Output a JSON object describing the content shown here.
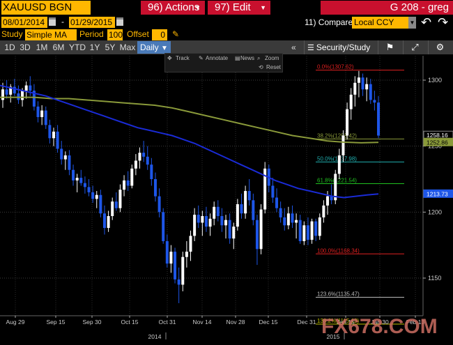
{
  "window": {
    "ticker": "XAUUSD BGN Curncy",
    "actions_label": "96) Actions",
    "edit_label": "97) Edit",
    "right_title": "G 208 - greg"
  },
  "controls": {
    "start_date": "08/01/2014",
    "end_date": "01/29/2015",
    "date_separator": "-",
    "compare_label": "11) Compare",
    "compare_currency": "Local CCY",
    "study_label": "Study",
    "study_value": "Simple MA",
    "period_label": "Period",
    "period_value": "100",
    "offset_label": "Offset",
    "offset_value": "0"
  },
  "toolbar": {
    "timeframes": [
      "1D",
      "3D",
      "1M",
      "6M",
      "YTD",
      "1Y",
      "5Y",
      "Max"
    ],
    "frequency": "Daily",
    "collapse_symbol": "«",
    "security_study_label": "Security/Study",
    "icons": [
      "flag-icon",
      "fullscreen-icon",
      "gear-icon"
    ]
  },
  "chart_tools": {
    "track": "Track",
    "annotate": "Annotate",
    "news": "News",
    "zoom": "Zoom",
    "reset": "Reset"
  },
  "watermark": {
    "text": "FX678.COM"
  },
  "colors": {
    "ticker_bg": "#ffb700",
    "menu_red": "#c8102e",
    "bull_candle": "#ffffff",
    "bear_candle": "#1e56e8",
    "ma100": "#1a2bd6",
    "ma200": "#8a9a3a",
    "fib_red": "#e02020",
    "fib_green": "#20c020",
    "fib_cyan": "#20b0b0",
    "last_price_tag": "#1e56e8",
    "ma_tag": "#8a9a3a"
  },
  "chart_data": {
    "type": "candlestick",
    "y_range": [
      1120,
      1330
    ],
    "y_ticks": [
      1150,
      1200,
      1250,
      1300
    ],
    "x_labels": [
      {
        "label": "Aug 29",
        "year": ""
      },
      {
        "label": "Sep 15",
        "year": ""
      },
      {
        "label": "Sep 30",
        "year": ""
      },
      {
        "label": "Oct 15",
        "year": ""
      },
      {
        "label": "Oct 31",
        "year": "2014"
      },
      {
        "label": "Nov 14",
        "year": ""
      },
      {
        "label": "Nov 28",
        "year": ""
      },
      {
        "label": "Dec 15",
        "year": ""
      },
      {
        "label": "Dec 31",
        "year": ""
      },
      {
        "label": "Jan 15",
        "year": "2015"
      },
      {
        "label": "Jan 30",
        "year": ""
      },
      {
        "label": "Feb 13",
        "year": ""
      }
    ],
    "fib_levels": [
      {
        "label": "0.0%",
        "value": 1307.62,
        "text": "1307.62",
        "color": "#e02020"
      },
      {
        "label": "38.2%",
        "value": 1255.42,
        "text": "1255.42",
        "color": "#8a9a3a"
      },
      {
        "label": "50.0%",
        "value": 1237.98,
        "text": "1237.98",
        "color": "#20b0b0"
      },
      {
        "label": "61.8%",
        "value": 1221.54,
        "text": "1221.54",
        "color": "#20c020"
      },
      {
        "label": "100.0%",
        "value": 1168.34,
        "text": "1168.34",
        "color": "#e02020"
      },
      {
        "label": "123.6%",
        "value": 1135.47,
        "text": "1135.47",
        "color": "#bbbbbb"
      },
      {
        "label": "138.2%",
        "value": 1115.13,
        "text": "1115.13",
        "color": "#c0c000"
      }
    ],
    "price_tags": [
      {
        "text": "1258.16",
        "value": 1258.16,
        "kind": "last"
      },
      {
        "text": "1252.86",
        "value": 1252.86,
        "kind": "ma200"
      },
      {
        "text": "1213.73",
        "value": 1213.73,
        "kind": "ma100"
      }
    ],
    "candles": [
      {
        "o": 1285,
        "h": 1298,
        "l": 1279,
        "c": 1293
      },
      {
        "o": 1293,
        "h": 1300,
        "l": 1286,
        "c": 1289
      },
      {
        "o": 1289,
        "h": 1297,
        "l": 1283,
        "c": 1295
      },
      {
        "o": 1295,
        "h": 1301,
        "l": 1288,
        "c": 1290
      },
      {
        "o": 1290,
        "h": 1296,
        "l": 1282,
        "c": 1285
      },
      {
        "o": 1285,
        "h": 1294,
        "l": 1280,
        "c": 1292
      },
      {
        "o": 1292,
        "h": 1299,
        "l": 1286,
        "c": 1296
      },
      {
        "o": 1296,
        "h": 1303,
        "l": 1288,
        "c": 1292
      },
      {
        "o": 1292,
        "h": 1297,
        "l": 1277,
        "c": 1280
      },
      {
        "o": 1280,
        "h": 1284,
        "l": 1268,
        "c": 1272
      },
      {
        "o": 1272,
        "h": 1281,
        "l": 1266,
        "c": 1277
      },
      {
        "o": 1277,
        "h": 1280,
        "l": 1263,
        "c": 1266
      },
      {
        "o": 1266,
        "h": 1270,
        "l": 1252,
        "c": 1256
      },
      {
        "o": 1256,
        "h": 1264,
        "l": 1250,
        "c": 1261
      },
      {
        "o": 1261,
        "h": 1266,
        "l": 1245,
        "c": 1248
      },
      {
        "o": 1248,
        "h": 1254,
        "l": 1236,
        "c": 1240
      },
      {
        "o": 1240,
        "h": 1246,
        "l": 1232,
        "c": 1243
      },
      {
        "o": 1243,
        "h": 1247,
        "l": 1228,
        "c": 1232
      },
      {
        "o": 1232,
        "h": 1236,
        "l": 1220,
        "c": 1224
      },
      {
        "o": 1224,
        "h": 1229,
        "l": 1215,
        "c": 1226
      },
      {
        "o": 1226,
        "h": 1232,
        "l": 1220,
        "c": 1222
      },
      {
        "o": 1222,
        "h": 1227,
        "l": 1214,
        "c": 1219
      },
      {
        "o": 1219,
        "h": 1225,
        "l": 1212,
        "c": 1215
      },
      {
        "o": 1215,
        "h": 1220,
        "l": 1207,
        "c": 1210
      },
      {
        "o": 1210,
        "h": 1216,
        "l": 1203,
        "c": 1213
      },
      {
        "o": 1213,
        "h": 1217,
        "l": 1196,
        "c": 1199
      },
      {
        "o": 1199,
        "h": 1205,
        "l": 1183,
        "c": 1188
      },
      {
        "o": 1188,
        "h": 1201,
        "l": 1185,
        "c": 1197
      },
      {
        "o": 1197,
        "h": 1211,
        "l": 1194,
        "c": 1208
      },
      {
        "o": 1208,
        "h": 1215,
        "l": 1201,
        "c": 1203
      },
      {
        "o": 1203,
        "h": 1221,
        "l": 1200,
        "c": 1217
      },
      {
        "o": 1217,
        "h": 1228,
        "l": 1212,
        "c": 1224
      },
      {
        "o": 1224,
        "h": 1231,
        "l": 1216,
        "c": 1220
      },
      {
        "o": 1220,
        "h": 1236,
        "l": 1218,
        "c": 1233
      },
      {
        "o": 1233,
        "h": 1244,
        "l": 1228,
        "c": 1239
      },
      {
        "o": 1239,
        "h": 1249,
        "l": 1233,
        "c": 1245
      },
      {
        "o": 1245,
        "h": 1254,
        "l": 1238,
        "c": 1242
      },
      {
        "o": 1242,
        "h": 1250,
        "l": 1232,
        "c": 1236
      },
      {
        "o": 1236,
        "h": 1241,
        "l": 1220,
        "c": 1225
      },
      {
        "o": 1225,
        "h": 1230,
        "l": 1208,
        "c": 1212
      },
      {
        "o": 1212,
        "h": 1218,
        "l": 1196,
        "c": 1200
      },
      {
        "o": 1200,
        "h": 1203,
        "l": 1176,
        "c": 1178
      },
      {
        "o": 1178,
        "h": 1183,
        "l": 1158,
        "c": 1161
      },
      {
        "o": 1161,
        "h": 1175,
        "l": 1154,
        "c": 1170
      },
      {
        "o": 1170,
        "h": 1173,
        "l": 1146,
        "c": 1149
      },
      {
        "o": 1149,
        "h": 1158,
        "l": 1131,
        "c": 1145
      },
      {
        "o": 1145,
        "h": 1170,
        "l": 1140,
        "c": 1166
      },
      {
        "o": 1166,
        "h": 1178,
        "l": 1158,
        "c": 1170
      },
      {
        "o": 1170,
        "h": 1186,
        "l": 1163,
        "c": 1182
      },
      {
        "o": 1182,
        "h": 1203,
        "l": 1178,
        "c": 1198
      },
      {
        "o": 1198,
        "h": 1205,
        "l": 1188,
        "c": 1192
      },
      {
        "o": 1192,
        "h": 1201,
        "l": 1182,
        "c": 1197
      },
      {
        "o": 1197,
        "h": 1204,
        "l": 1185,
        "c": 1189
      },
      {
        "o": 1189,
        "h": 1199,
        "l": 1182,
        "c": 1195
      },
      {
        "o": 1195,
        "h": 1208,
        "l": 1190,
        "c": 1204
      },
      {
        "o": 1204,
        "h": 1209,
        "l": 1193,
        "c": 1197
      },
      {
        "o": 1197,
        "h": 1203,
        "l": 1185,
        "c": 1190
      },
      {
        "o": 1190,
        "h": 1198,
        "l": 1180,
        "c": 1194
      },
      {
        "o": 1194,
        "h": 1199,
        "l": 1176,
        "c": 1180
      },
      {
        "o": 1180,
        "h": 1192,
        "l": 1172,
        "c": 1189
      },
      {
        "o": 1189,
        "h": 1210,
        "l": 1186,
        "c": 1206
      },
      {
        "o": 1206,
        "h": 1214,
        "l": 1195,
        "c": 1199
      },
      {
        "o": 1199,
        "h": 1220,
        "l": 1195,
        "c": 1216
      },
      {
        "o": 1216,
        "h": 1225,
        "l": 1205,
        "c": 1209
      },
      {
        "o": 1209,
        "h": 1214,
        "l": 1190,
        "c": 1194
      },
      {
        "o": 1194,
        "h": 1198,
        "l": 1160,
        "c": 1172
      },
      {
        "o": 1172,
        "h": 1206,
        "l": 1168,
        "c": 1202
      },
      {
        "o": 1202,
        "h": 1238,
        "l": 1199,
        "c": 1233
      },
      {
        "o": 1233,
        "h": 1236,
        "l": 1215,
        "c": 1220
      },
      {
        "o": 1220,
        "h": 1226,
        "l": 1207,
        "c": 1211
      },
      {
        "o": 1211,
        "h": 1218,
        "l": 1200,
        "c": 1203
      },
      {
        "o": 1203,
        "h": 1208,
        "l": 1192,
        "c": 1196
      },
      {
        "o": 1196,
        "h": 1203,
        "l": 1186,
        "c": 1190
      },
      {
        "o": 1190,
        "h": 1204,
        "l": 1187,
        "c": 1199
      },
      {
        "o": 1199,
        "h": 1205,
        "l": 1188,
        "c": 1192
      },
      {
        "o": 1192,
        "h": 1199,
        "l": 1180,
        "c": 1194
      },
      {
        "o": 1194,
        "h": 1198,
        "l": 1176,
        "c": 1178
      },
      {
        "o": 1178,
        "h": 1193,
        "l": 1175,
        "c": 1190
      },
      {
        "o": 1190,
        "h": 1196,
        "l": 1175,
        "c": 1179
      },
      {
        "o": 1179,
        "h": 1195,
        "l": 1176,
        "c": 1193
      },
      {
        "o": 1193,
        "h": 1195,
        "l": 1178,
        "c": 1182
      },
      {
        "o": 1182,
        "h": 1199,
        "l": 1179,
        "c": 1196
      },
      {
        "o": 1196,
        "h": 1209,
        "l": 1192,
        "c": 1205
      },
      {
        "o": 1205,
        "h": 1216,
        "l": 1198,
        "c": 1212
      },
      {
        "o": 1212,
        "h": 1221,
        "l": 1206,
        "c": 1209
      },
      {
        "o": 1209,
        "h": 1232,
        "l": 1206,
        "c": 1229
      },
      {
        "o": 1229,
        "h": 1248,
        "l": 1225,
        "c": 1243
      },
      {
        "o": 1243,
        "h": 1262,
        "l": 1238,
        "c": 1258
      },
      {
        "o": 1258,
        "h": 1283,
        "l": 1255,
        "c": 1278
      },
      {
        "o": 1278,
        "h": 1294,
        "l": 1270,
        "c": 1289
      },
      {
        "o": 1289,
        "h": 1303,
        "l": 1280,
        "c": 1298
      },
      {
        "o": 1298,
        "h": 1307,
        "l": 1287,
        "c": 1302
      },
      {
        "o": 1302,
        "h": 1305,
        "l": 1288,
        "c": 1293
      },
      {
        "o": 1293,
        "h": 1302,
        "l": 1284,
        "c": 1297
      },
      {
        "o": 1297,
        "h": 1301,
        "l": 1282,
        "c": 1285
      },
      {
        "o": 1285,
        "h": 1292,
        "l": 1277,
        "c": 1283
      },
      {
        "o": 1283,
        "h": 1288,
        "l": 1256,
        "c": 1258
      }
    ],
    "ma100": [
      1296,
      1294,
      1292,
      1290,
      1288,
      1285,
      1282,
      1279,
      1276,
      1273,
      1270,
      1267,
      1264,
      1262,
      1260,
      1258,
      1255,
      1252,
      1248,
      1244,
      1240,
      1236,
      1232,
      1228,
      1224,
      1221,
      1218,
      1216,
      1214,
      1212,
      1211,
      1212,
      1213,
      1213.73
    ],
    "ma200": [
      1287,
      1287,
      1287,
      1286,
      1286,
      1285,
      1284,
      1283,
      1282,
      1281,
      1279,
      1276,
      1273,
      1270,
      1267,
      1264,
      1261,
      1258,
      1256,
      1254,
      1253,
      1252.5,
      1252.86
    ]
  }
}
